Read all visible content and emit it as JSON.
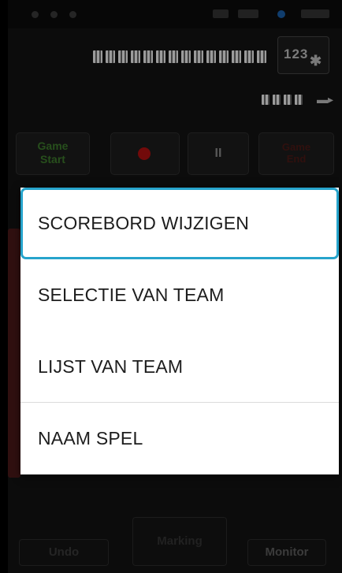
{
  "toolbar": {
    "game_start_label_line1": "Game",
    "game_start_label_line2": "Start",
    "pause_label": "II",
    "game_end_label_line1": "Game",
    "game_end_label_line2": "End"
  },
  "settings": {
    "counter_label": "123"
  },
  "menu": {
    "items": [
      {
        "label": "SCOREBORD WIJZIGEN"
      },
      {
        "label": "SELECTIE VAN TEAM"
      },
      {
        "label": "LIJST VAN TEAM"
      },
      {
        "label": "NAAM SPEL"
      }
    ]
  },
  "bottom": {
    "undo_label": "Undo",
    "marking_label": "Marking",
    "monitor_label": "Monitor"
  },
  "colors": {
    "menu_focus": "#26a4cc",
    "record": "#b01010",
    "game_start": "#3d7a2c"
  }
}
